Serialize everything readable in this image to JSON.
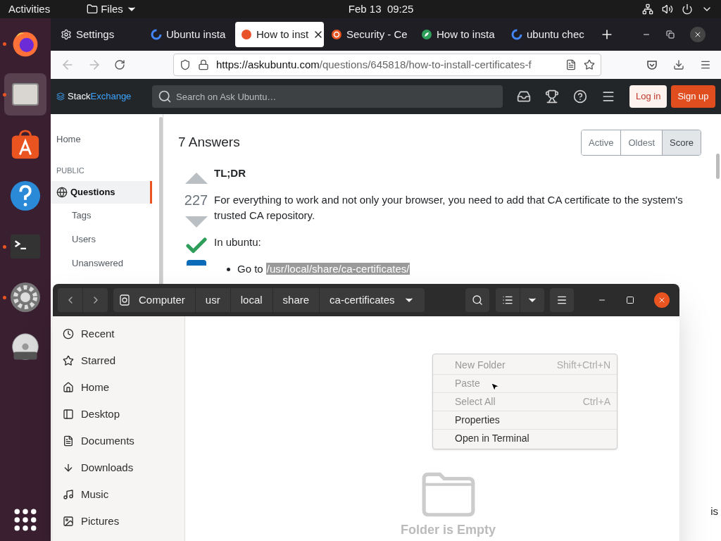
{
  "top_bar": {
    "activities": "Activities",
    "app_menu": "Files",
    "clock": "Feb 13  09:25"
  },
  "browser": {
    "tabs": [
      {
        "label": "Settings",
        "selected": false
      },
      {
        "label": "Ubuntu insta",
        "selected": false
      },
      {
        "label": "How to inst",
        "selected": true
      },
      {
        "label": "Security - Ce",
        "selected": false
      },
      {
        "label": "How to insta",
        "selected": false
      },
      {
        "label": "ubuntu chec",
        "selected": false
      }
    ],
    "url_host": "https://askubuntu.com",
    "url_path": "/questions/645818/how-to-install-certificates-f"
  },
  "site": {
    "logo_first": "Stack",
    "logo_second": "Exchange",
    "search_placeholder": "Search on Ask Ubuntu…",
    "login": "Log in",
    "signup": "Sign up",
    "nav": [
      {
        "label": "Home",
        "kind": "link",
        "selected": false
      },
      {
        "label": "PUBLIC",
        "kind": "heading",
        "selected": false
      },
      {
        "label": "Questions",
        "kind": "main",
        "selected": true
      },
      {
        "label": "Tags",
        "kind": "sub",
        "selected": false
      },
      {
        "label": "Users",
        "kind": "sub",
        "selected": false
      },
      {
        "label": "Unanswered",
        "kind": "sub",
        "selected": false
      }
    ],
    "answers_title": "7 Answers",
    "sort": [
      {
        "label": "Active",
        "selected": false
      },
      {
        "label": "Oldest",
        "selected": false
      },
      {
        "label": "Score",
        "selected": true
      }
    ],
    "score": "227",
    "accepted": true,
    "tldr": "TL;DR",
    "paragraph": "For everything to work and not only your browser, you need to add that CA certificate to the system's trusted CA repository.",
    "in_ubuntu": "In ubuntu:",
    "step_prefix": "Go to",
    "step_path": "/usr/local/share/ca-certificates/",
    "trailing": "is"
  },
  "files": {
    "path": [
      "Computer",
      "usr",
      "local",
      "share",
      "ca-certificates"
    ],
    "places": [
      "Recent",
      "Starred",
      "Home",
      "Desktop",
      "Documents",
      "Downloads",
      "Music",
      "Pictures"
    ],
    "empty_text": "Folder is Empty",
    "menu": [
      {
        "label": "New Folder",
        "shortcut": "Shift+Ctrl+N",
        "disabled": true
      },
      {
        "label": "Paste",
        "disabled": true
      },
      {
        "label": "Select All",
        "shortcut": "Ctrl+A",
        "disabled": true
      },
      {
        "label": "Properties",
        "disabled": false
      },
      {
        "label": "Open in Terminal",
        "disabled": false
      }
    ]
  }
}
